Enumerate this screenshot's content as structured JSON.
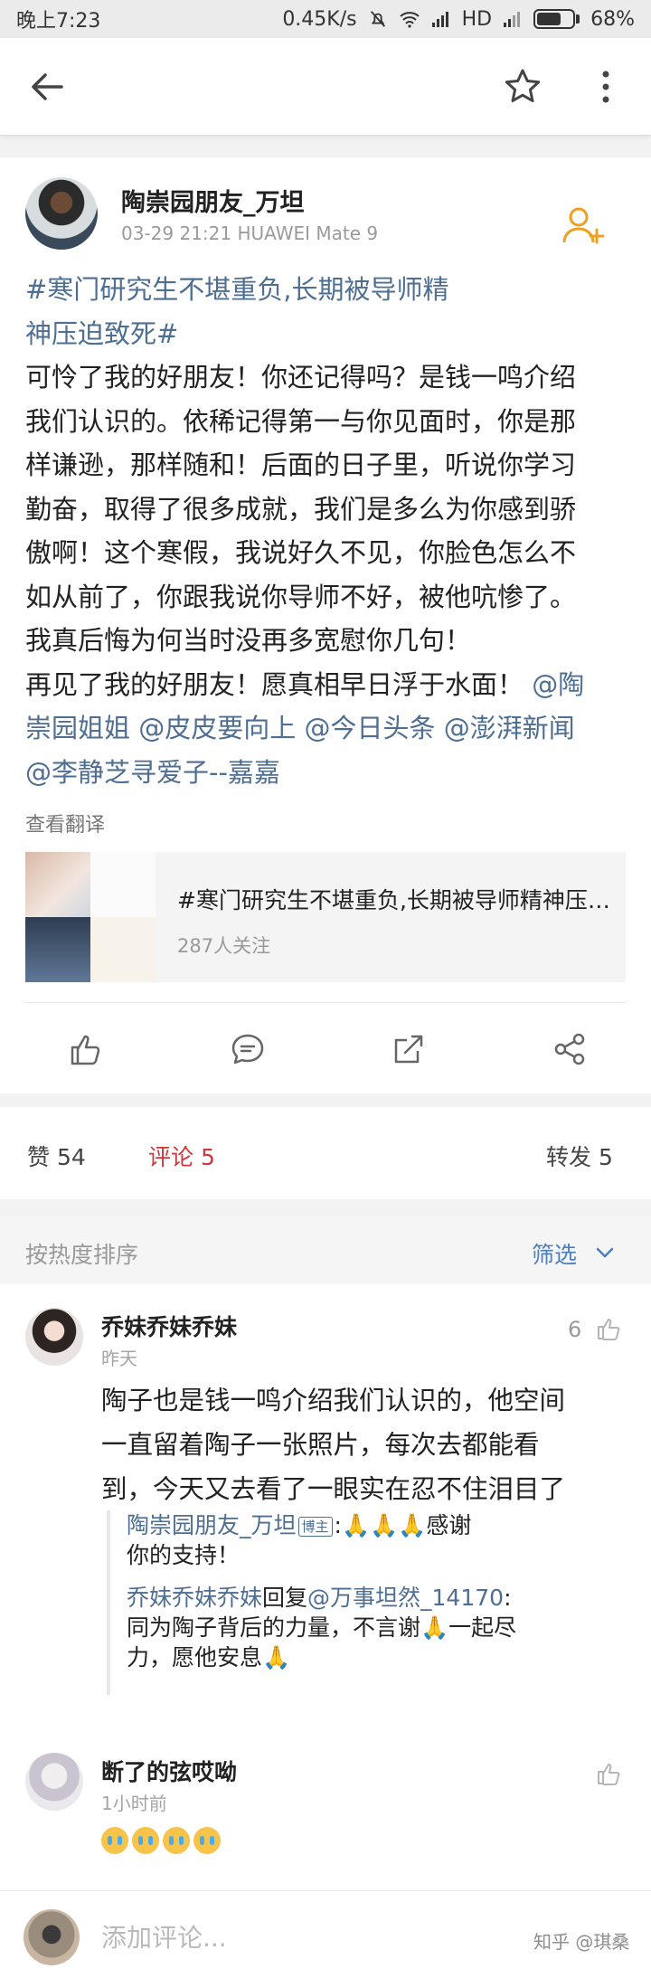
{
  "status_bar": {
    "time": "晚上7:23",
    "speed": "0.45K/s",
    "network": "HD",
    "battery": "68%",
    "battery_level": 0.68
  },
  "post": {
    "author": "陶崇园朋友_万坦",
    "meta": "03-29 21:21    HUAWEI Mate 9",
    "hashtag_line1": "#寒门研究生不堪重负,长期被导师精",
    "hashtag_line2": "神压迫致死#",
    "body_lines": [
      "可怜了我的好朋友！你还记得吗？是钱一鸣介绍",
      "我们认识的。依稀记得第一与你见面时，你是那",
      "样谦逊，那样随和！后面的日子里，听说你学习",
      "勤奋，取得了很多成就，我们是多么为你感到骄",
      "傲啊！这个寒假，我说好久不见，你脸色怎么不",
      "如从前了，你跟我说你导师不好，被他吭惨了。",
      "我真后悔为何当时没再多宽慰你几句！"
    ],
    "closing_text": "再见了我的好朋友！愿真相早日浮于水面！",
    "mention1": "@陶",
    "mention2": "崇园姐姐",
    "mention3": "@皮皮要向上",
    "mention4": "@今日头条",
    "mention5": "@澎湃新闻",
    "mention6": "@李静芝寻爱子--嘉嘉",
    "translate": "查看翻译",
    "topic_title": "#寒门研究生不堪重负,长期被导师精神压迫致死#",
    "topic_followers": "287人关注"
  },
  "stats": {
    "likes": "赞 54",
    "comments": "评论 5",
    "reposts": "转发 5",
    "active_color": "#d0363a"
  },
  "comments_section": {
    "sort_label": "按热度排序",
    "filter_label": "筛选"
  },
  "comments": [
    {
      "name": "乔妹乔妹乔妹",
      "time": "昨天",
      "likes": "6",
      "text_lines": [
        "陶子也是钱一鸣介绍我们认识的，他空间",
        "一直留着陶子一张照片，每次去都能看",
        "到，今天又去看了一眼实在忍不住泪目了"
      ],
      "reply1_author": "陶崇园朋友_万坦",
      "reply1_badge": "博主",
      "reply1_text_a": ":🙏🙏🙏感谢",
      "reply1_text_b": "你的支持！",
      "reply2_author": "乔妹乔妹乔妹",
      "reply2_verb": "回复",
      "reply2_target": "@万事坦然_14170",
      "reply2_colon": ":",
      "reply2_line2": "同为陶子背后的力量，不言谢🙏一起尽",
      "reply2_line3": "力，愿他安息🙏"
    },
    {
      "name": "断了的弦哎呦",
      "time": "1小时前",
      "emoji": "crying-face x4"
    }
  ],
  "input": {
    "placeholder": "添加评论...",
    "watermark": "知乎 @琪桑"
  }
}
